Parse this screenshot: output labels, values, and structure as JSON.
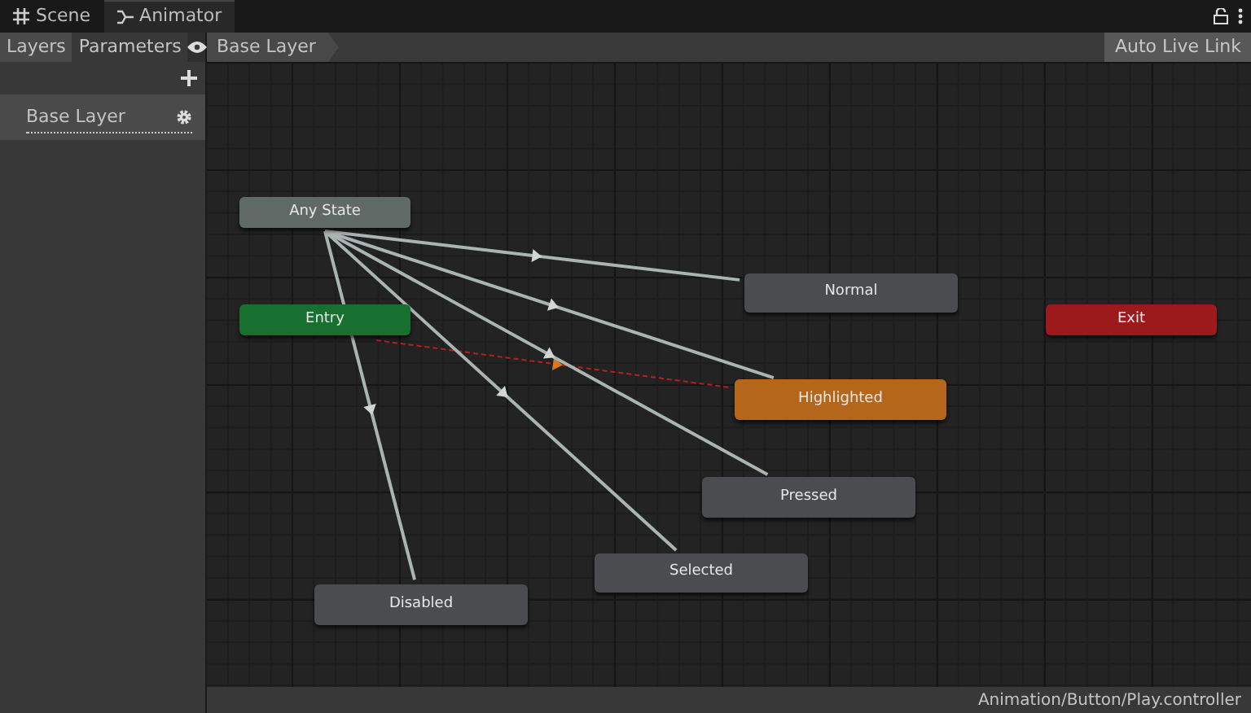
{
  "window_tabs": [
    {
      "kind": "scene",
      "label": "Scene",
      "selected": false
    },
    {
      "kind": "animator",
      "label": "Animator",
      "selected": true
    }
  ],
  "side_tabs": [
    {
      "label": "Layers",
      "selected": true
    },
    {
      "label": "Parameters",
      "selected": false
    }
  ],
  "layers": [
    {
      "name": "Base Layer",
      "selected": true
    }
  ],
  "breadcrumb": [
    "Base Layer"
  ],
  "toolbar_button": {
    "label": "Auto Live Link",
    "on": false
  },
  "nodes": [
    {
      "kind": "any",
      "label": "Any State",
      "color": "#5f6a66"
    },
    {
      "kind": "entry",
      "label": "Entry",
      "color": "#17702f"
    },
    {
      "kind": "state",
      "label": "Normal",
      "color": "#4a4c50"
    },
    {
      "kind": "exit",
      "label": "Exit",
      "color": "#9c1a1c"
    },
    {
      "kind": "default",
      "label": "Highlighted",
      "color": "#b4661a"
    },
    {
      "kind": "state",
      "label": "Pressed",
      "color": "#4a4c50"
    },
    {
      "kind": "state",
      "label": "Selected",
      "color": "#4a4c50"
    },
    {
      "kind": "state",
      "label": "Disabled",
      "color": "#4a4c50"
    }
  ],
  "status_bar": "Animation/Button/Play.controller"
}
